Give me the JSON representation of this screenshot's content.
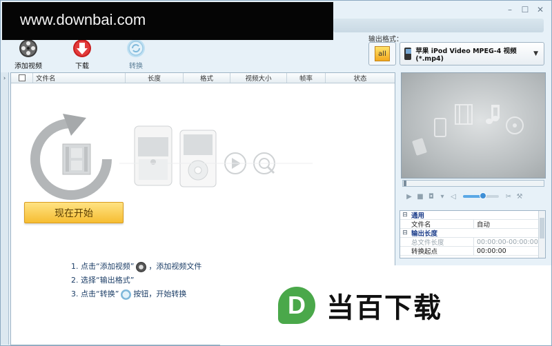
{
  "watermark": {
    "top_text": "www.downbai.com",
    "bottom_logo_letter": "D",
    "bottom_text": "当百下载"
  },
  "window": {
    "min": "–",
    "max": "☐",
    "close": "✕"
  },
  "toolbar": {
    "items": [
      {
        "label": "添加视频",
        "icon": "film-reel-icon"
      },
      {
        "label": "下载",
        "icon": "download-icon"
      },
      {
        "label": "转换",
        "icon": "convert-icon"
      }
    ]
  },
  "output_format": {
    "label": "输出格式：",
    "all_label": "all",
    "selected": "苹果 iPod Video MPEG-4 视频 (*.mp4)",
    "arrow": "▼"
  },
  "list": {
    "columns": [
      "文件名",
      "长度",
      "格式",
      "视频大小",
      "帧率",
      "状态"
    ],
    "collapse": "›"
  },
  "start_button": "现在开始",
  "steps": {
    "step1_a": "1. 点击“添加视频”",
    "step1_b": "，添加视频文件",
    "step2": "2. 选择“输出格式”",
    "step3_a": "3. 点击“转换”",
    "step3_b": "按钮，开始转换"
  },
  "properties": {
    "rows": [
      {
        "type": "category",
        "expander": "⊟",
        "key": "通用",
        "value": ""
      },
      {
        "type": "item",
        "expander": "",
        "key": "文件名",
        "value": "自动"
      },
      {
        "type": "category",
        "expander": "⊟",
        "key": "输出长度",
        "value": ""
      },
      {
        "type": "item-dim",
        "expander": "",
        "key": "总文件长度",
        "value": "00:00:00-00:00:00"
      },
      {
        "type": "item",
        "expander": "",
        "key": "转换起点",
        "value": "00:00:00"
      }
    ]
  },
  "colors": {
    "accent": "#f6bd32",
    "panel_border": "#9db3c5",
    "step_text": "#1b3d66",
    "watermark_green": "#4aa84a"
  }
}
